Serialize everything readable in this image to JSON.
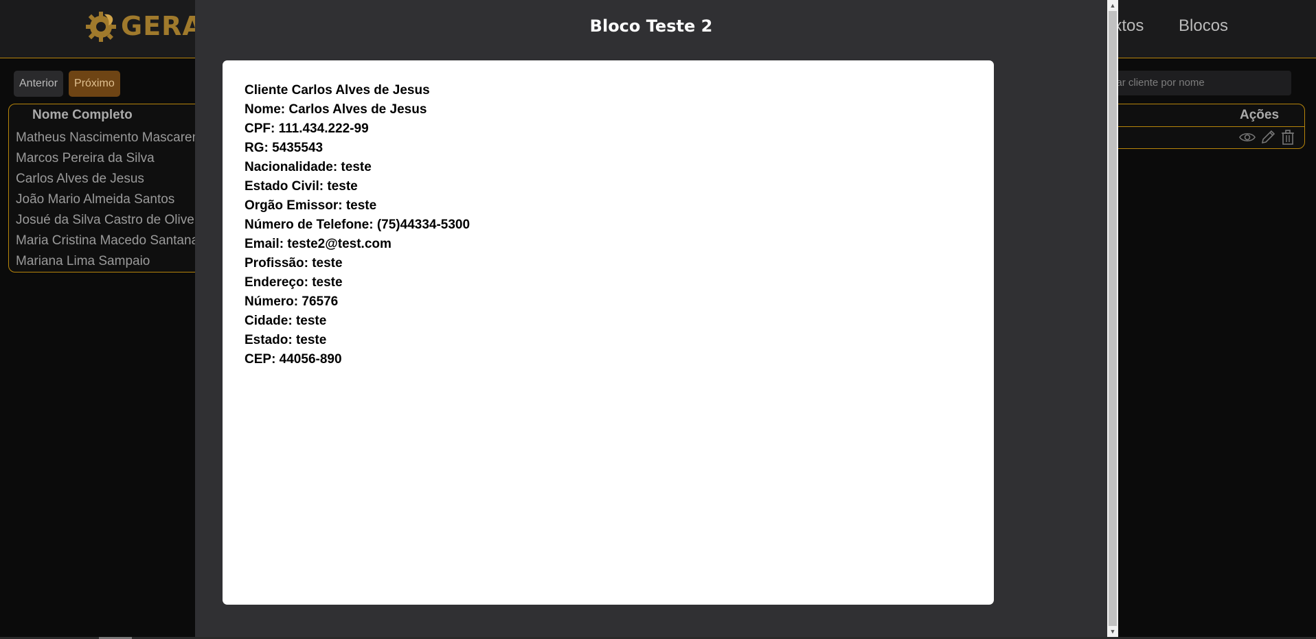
{
  "header": {
    "logo_text": "GERADO",
    "nav": {
      "textos": "extos",
      "blocos": "Blocos"
    }
  },
  "pager": {
    "prev_label": "Anterior",
    "next_label": "Próximo"
  },
  "search": {
    "placeholder": "Pesquisar cliente por nome"
  },
  "clients_table": {
    "header": "Nome Completo",
    "rows": [
      "Matheus Nascimento Mascarenhas",
      "Marcos Pereira da Silva",
      "Carlos Alves de Jesus",
      "João Mario Almeida Santos",
      "Josué da Silva Castro de Oliveira",
      "Maria Cristina Macedo Santana",
      "Mariana Lima Sampaio"
    ]
  },
  "actions_table": {
    "header": "Ações",
    "icons": [
      "eye-icon",
      "pencil-icon",
      "trash-icon"
    ]
  },
  "modal": {
    "title": "Bloco Teste 2",
    "lines": [
      "Cliente Carlos Alves de Jesus",
      "Nome: Carlos Alves de Jesus",
      "CPF: 111.434.222-99",
      "RG: 5435543",
      "Nacionalidade: teste",
      "Estado Civil: teste",
      "Orgão Emissor: teste",
      "Número de Telefone: (75)44334-5300",
      "Email: teste2@test.com",
      "Profissão: teste",
      "Endereço: teste",
      "Número: 76576",
      "Cidade: teste",
      "Estado: teste",
      "CEP: 44056-890"
    ]
  },
  "colors": {
    "accent_gold": "#b8860b",
    "modal_bg": "#303033",
    "page_bg": "#0b0b0b",
    "next_button": "#6e4414"
  }
}
